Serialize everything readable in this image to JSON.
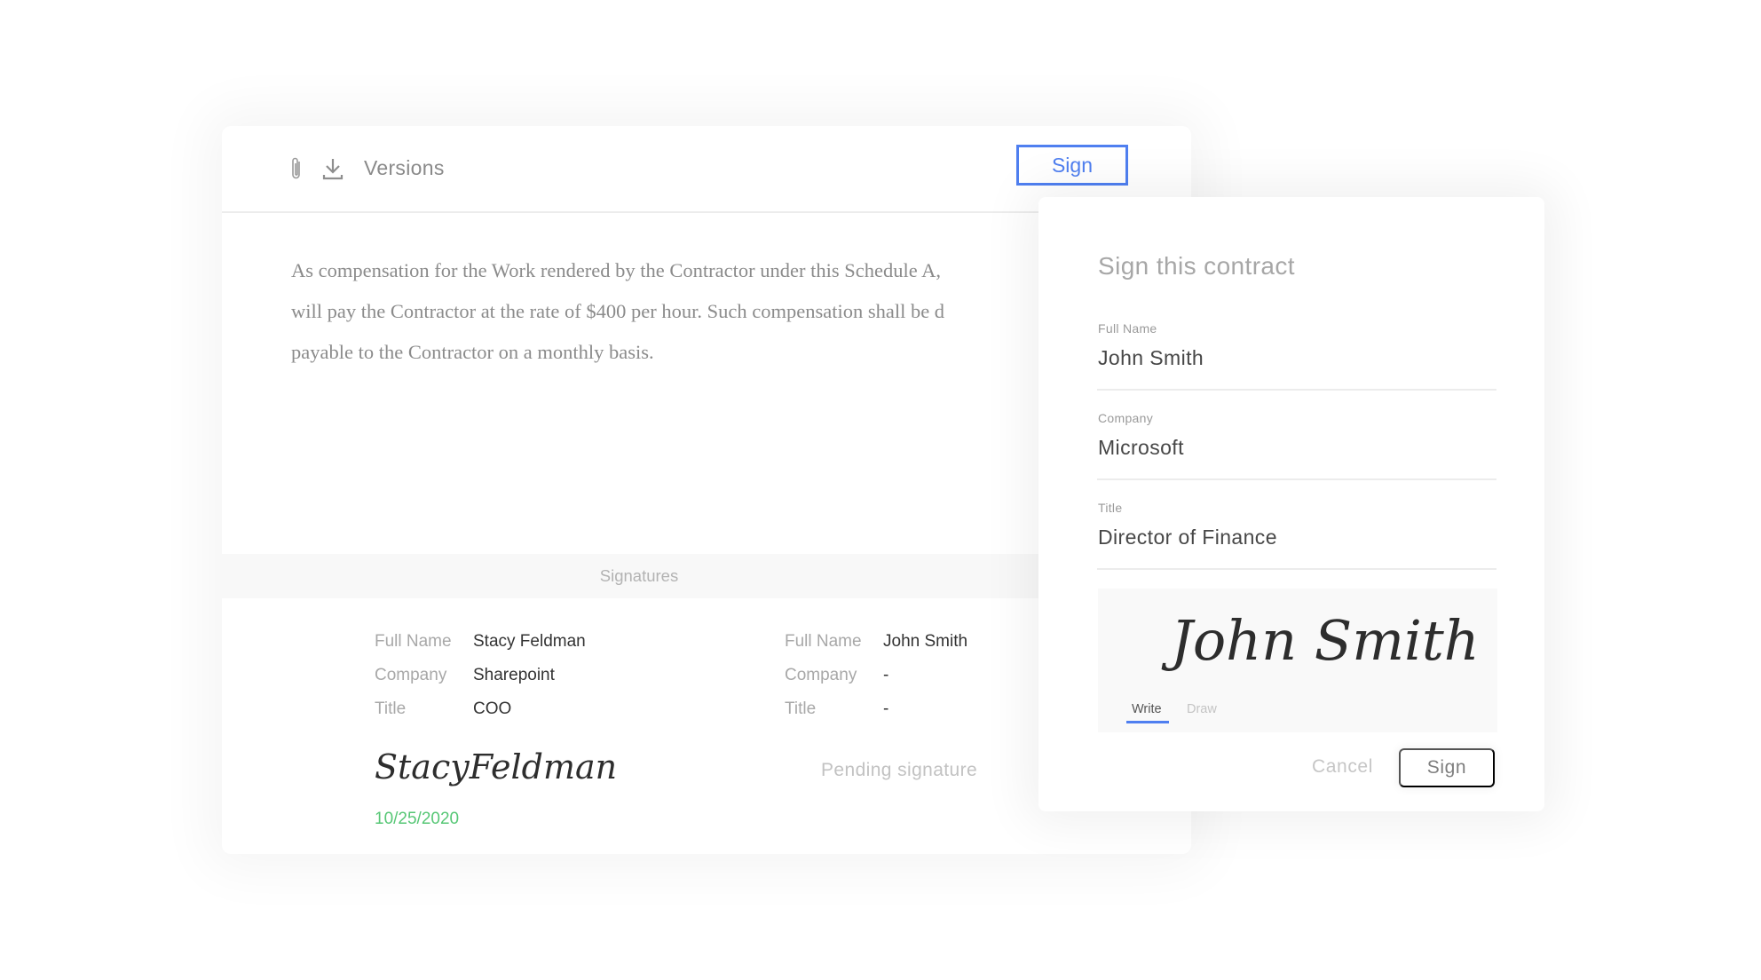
{
  "document": {
    "toolbar": {
      "attach_icon": "paperclip-icon",
      "download_icon": "download-icon",
      "versions_label": "Versions",
      "sign_label": "Sign"
    },
    "body_lines": [
      "As compensation for the Work rendered by the Contractor under this Schedule A, ",
      "will pay the Contractor at the rate of $400 per hour. Such compensation shall be d",
      "payable to the Contractor on a monthly basis."
    ],
    "signatures_heading": "Signatures",
    "signers": [
      {
        "fields": [
          {
            "label": "Full Name",
            "value": "Stacy Feldman"
          },
          {
            "label": "Company",
            "value": "Sharepoint"
          },
          {
            "label": "Title",
            "value": "COO"
          }
        ],
        "signature": "StacyFeldman",
        "date": "10/25/2020"
      },
      {
        "fields": [
          {
            "label": "Full Name",
            "value": "John Smith"
          },
          {
            "label": "Company",
            "value": "-"
          },
          {
            "label": "Title",
            "value": "-"
          }
        ],
        "status": "Pending signature"
      }
    ]
  },
  "modal": {
    "title": "Sign this contract",
    "fields": [
      {
        "label": "Full Name",
        "value": "John Smith"
      },
      {
        "label": "Company",
        "value": "Microsoft"
      },
      {
        "label": "Title",
        "value": "Director of Finance"
      }
    ],
    "signature_preview": "John Smith",
    "tabs": [
      {
        "label": "Write",
        "active": true
      },
      {
        "label": "Draw",
        "active": false
      }
    ],
    "cancel_label": "Cancel",
    "sign_label": "Sign"
  },
  "colors": {
    "accent": "#4f7ff0",
    "date_green": "#57c776"
  }
}
